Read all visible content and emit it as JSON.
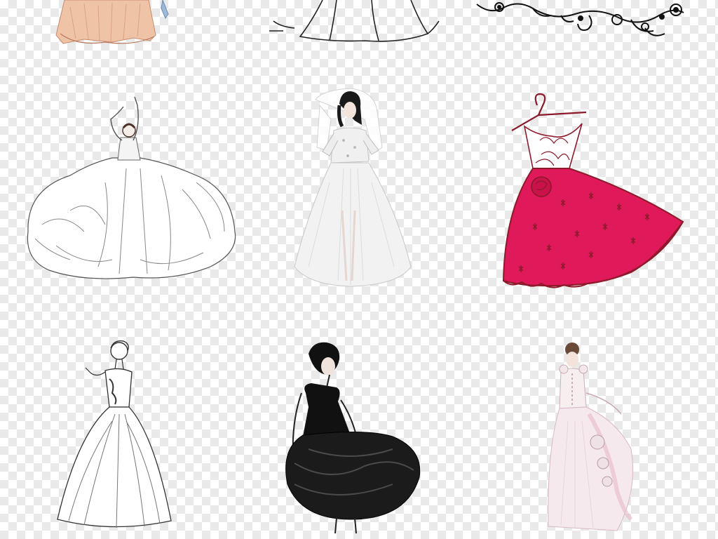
{
  "background": {
    "pattern": "transparency-checkerboard",
    "colors": [
      "#ffffff",
      "#e9e9e9"
    ]
  },
  "illustrations": [
    {
      "name": "partial-dress-sketch-top-left",
      "icon": "dress-icon",
      "colors": [
        "#e8b89a",
        "#c98a6a"
      ]
    },
    {
      "name": "partial-gown-outline-top-center",
      "icon": "dress-outline-icon",
      "colors": [
        "#222222"
      ]
    },
    {
      "name": "floral-swirl-ornament-top-right",
      "icon": "swirl-ornament-icon",
      "colors": [
        "#111111"
      ]
    },
    {
      "name": "ball-gown-arms-raised-sketch",
      "icon": "ball-gown-icon",
      "colors": [
        "#ffffff",
        "#555555"
      ]
    },
    {
      "name": "bride-with-veil-illustration",
      "icon": "bride-icon",
      "colors": [
        "#f2f2f2",
        "#1a1a1a"
      ]
    },
    {
      "name": "red-dress-on-hanger",
      "icon": "hanger-dress-icon",
      "colors": [
        "#e0195a",
        "#8c1a2a"
      ]
    },
    {
      "name": "strapless-gown-line-sketch",
      "icon": "gown-sketch-icon",
      "colors": [
        "#ffffff",
        "#333333"
      ]
    },
    {
      "name": "black-cocktail-dress-illustration",
      "icon": "cocktail-dress-icon",
      "colors": [
        "#111111",
        "#d8c7c0"
      ]
    },
    {
      "name": "pink-rose-wedding-gown-back-view",
      "icon": "rose-gown-icon",
      "colors": [
        "#f6e9ee",
        "#e7b9c8"
      ]
    }
  ]
}
